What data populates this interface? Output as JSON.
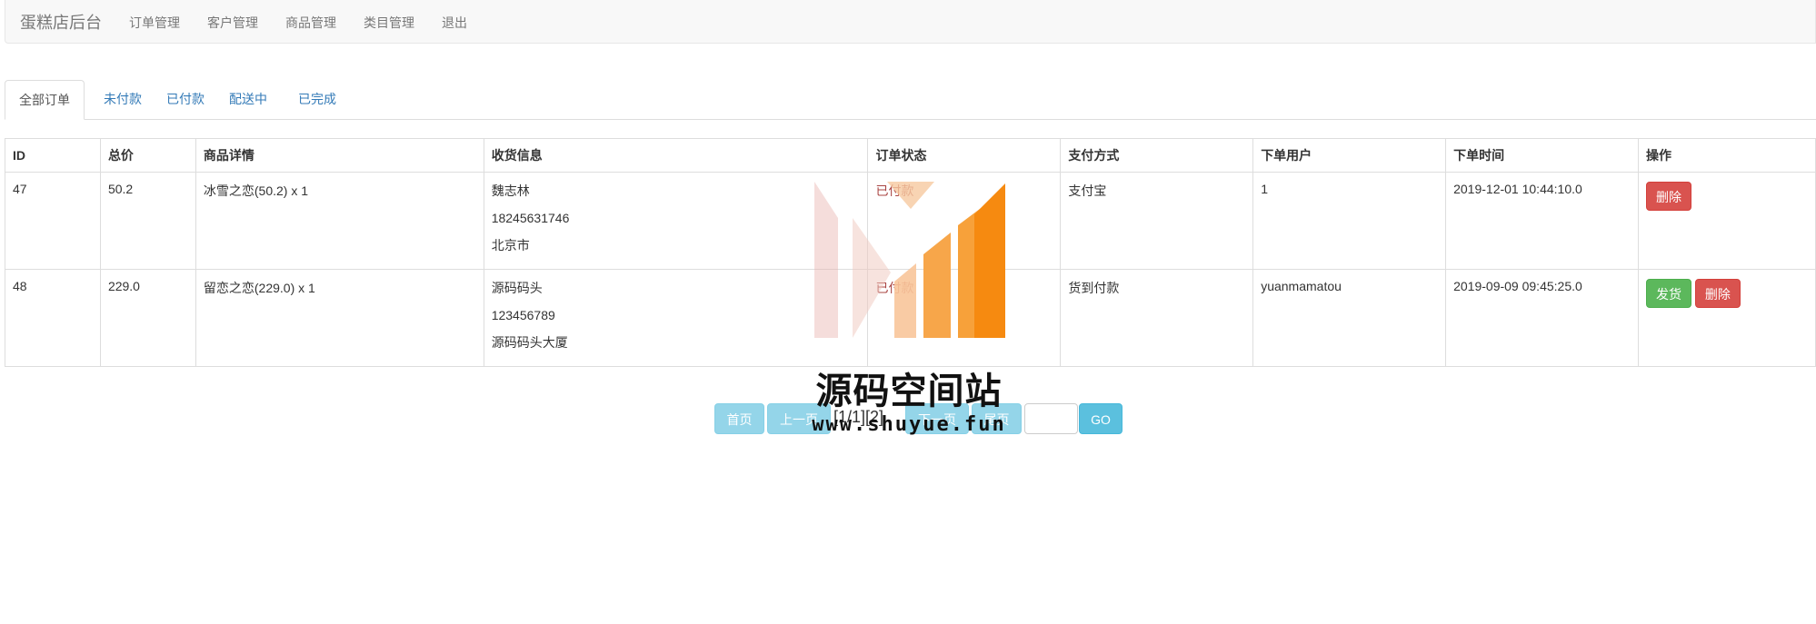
{
  "navbar": {
    "brand": "蛋糕店后台",
    "links": [
      "订单管理",
      "客户管理",
      "商品管理",
      "类目管理",
      "退出"
    ]
  },
  "tabs": [
    "全部订单",
    "未付款",
    "已付款",
    "配送中",
    "已完成"
  ],
  "table": {
    "headers": [
      "ID",
      "总价",
      "商品详情",
      "收货信息",
      "订单状态",
      "支付方式",
      "下单用户",
      "下单时间",
      "操作"
    ],
    "rows": [
      {
        "id": "47",
        "total": "50.2",
        "items": "冰雪之恋(50.2) x 1",
        "receiver": {
          "name": "魏志林",
          "phone": "18245631746",
          "address": "北京市"
        },
        "status": "已付款",
        "payment": "支付宝",
        "user": "1",
        "time": "2019-12-01 10:44:10.0",
        "actions": [
          "删除"
        ]
      },
      {
        "id": "48",
        "total": "229.0",
        "items": "留恋之恋(229.0) x 1",
        "receiver": {
          "name": "源码码头",
          "phone": "123456789",
          "address": "源码码头大厦"
        },
        "status": "已付款",
        "payment": "货到付款",
        "user": "yuanmamatou",
        "time": "2019-09-09 09:45:25.0",
        "actions": [
          "发货",
          "删除"
        ]
      }
    ]
  },
  "pagination": {
    "first": "首页",
    "prev": "上一页",
    "info": "[1/1][2]",
    "next": "下一页",
    "last": "尾页",
    "input_value": "",
    "go": "GO"
  },
  "watermark": {
    "title": "源码空间站",
    "url": "www.shuyue.fun"
  },
  "colors": {
    "link": "#337ab7",
    "danger": "#d9534f",
    "success": "#5cb85c",
    "info": "#5bc0de",
    "status": "#a94442"
  }
}
